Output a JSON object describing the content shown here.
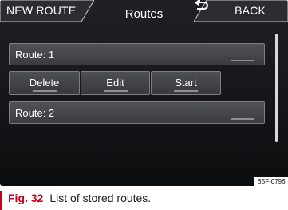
{
  "header": {
    "left_tab": "NEW ROUTE",
    "title": "Routes",
    "right_tab": "BACK"
  },
  "routes": [
    {
      "label": "Route: 1"
    },
    {
      "label": "Route: 2"
    }
  ],
  "actions": {
    "delete": "Delete",
    "edit": "Edit",
    "start": "Start"
  },
  "image_code": "B5F-0796",
  "caption": {
    "figure": "Fig. 32",
    "text": "List of stored routes."
  },
  "colors": {
    "accent_red": "#c9001b",
    "screen_bg": "#1f2124",
    "row_bg": "#505356"
  },
  "icons": {
    "back": "return-arrow-icon"
  }
}
